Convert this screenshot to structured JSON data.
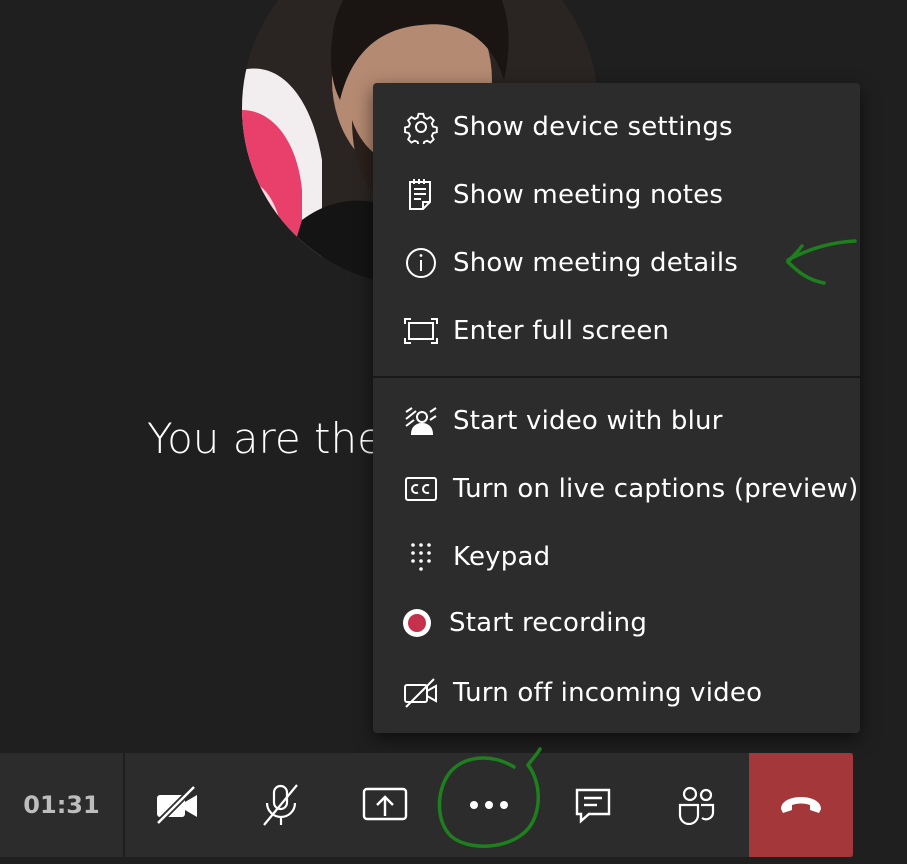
{
  "call": {
    "caption": "You are the",
    "timer": "01:31"
  },
  "menu": {
    "items": [
      {
        "label": "Show device settings",
        "icon": "gear-icon"
      },
      {
        "label": "Show meeting notes",
        "icon": "notes-icon"
      },
      {
        "label": "Show meeting details",
        "icon": "info-icon"
      },
      {
        "label": "Enter full screen",
        "icon": "fullscreen-icon"
      },
      {
        "label": "Start video with blur",
        "icon": "blur-video-icon"
      },
      {
        "label": "Turn on live captions (preview)",
        "icon": "captions-icon"
      },
      {
        "label": "Keypad",
        "icon": "keypad-icon"
      },
      {
        "label": "Start recording",
        "icon": "record-icon"
      },
      {
        "label": "Turn off incoming video",
        "icon": "video-off-icon"
      }
    ]
  },
  "toolbar": {
    "buttons": [
      {
        "icon": "camera-off-icon"
      },
      {
        "icon": "mic-off-icon"
      },
      {
        "icon": "share-screen-icon"
      },
      {
        "icon": "more-options-icon"
      },
      {
        "icon": "chat-icon"
      },
      {
        "icon": "participants-icon"
      },
      {
        "icon": "hang-up-icon"
      }
    ]
  },
  "colors": {
    "background": "#1f1f1f",
    "menu_bg": "#2d2c2c",
    "hangup": "#a4373a",
    "record_dot": "#c4314b",
    "annotation": "#1e7f1e"
  }
}
